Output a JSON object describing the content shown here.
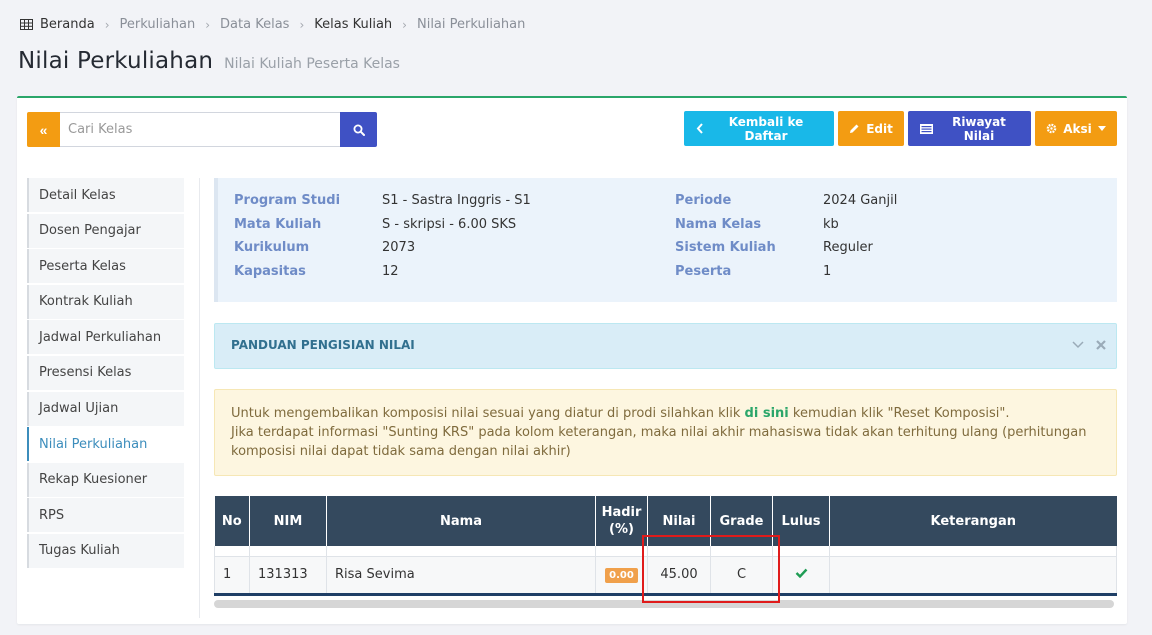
{
  "breadcrumb": {
    "items": [
      "Beranda",
      "Perkuliahan",
      "Data Kelas",
      "Kelas Kuliah",
      "Nilai Perkuliahan"
    ]
  },
  "page": {
    "title": "Nilai Perkuliahan",
    "subtitle": "Nilai Kuliah Peserta Kelas"
  },
  "toolbar": {
    "collapse_label": "«",
    "search_placeholder": "Cari Kelas",
    "back_label": "Kembali ke Daftar",
    "edit_label": "Edit",
    "history_label": "Riwayat Nilai",
    "actions_label": "Aksi"
  },
  "sidebar": {
    "items": [
      {
        "label": "Detail Kelas"
      },
      {
        "label": "Dosen Pengajar"
      },
      {
        "label": "Peserta Kelas"
      },
      {
        "label": "Kontrak Kuliah"
      },
      {
        "label": "Jadwal Perkuliahan"
      },
      {
        "label": "Presensi Kelas"
      },
      {
        "label": "Jadwal Ujian"
      },
      {
        "label": "Nilai Perkuliahan"
      },
      {
        "label": "Rekap Kuesioner"
      },
      {
        "label": "RPS"
      },
      {
        "label": "Tugas Kuliah"
      }
    ],
    "active_index": 7
  },
  "info": {
    "program_studi_label": "Program Studi",
    "program_studi": "S1 - Sastra Inggris - S1",
    "mata_kuliah_label": "Mata Kuliah",
    "mata_kuliah": "S - skripsi - 6.00 SKS",
    "kurikulum_label": "Kurikulum",
    "kurikulum": "2073",
    "kapasitas_label": "Kapasitas",
    "kapasitas": "12",
    "periode_label": "Periode",
    "periode": "2024 Ganjil",
    "nama_kelas_label": "Nama Kelas",
    "nama_kelas": "kb",
    "sistem_kuliah_label": "Sistem Kuliah",
    "sistem_kuliah": "Reguler",
    "peserta_label": "Peserta",
    "peserta": "1"
  },
  "guide": {
    "title": "PANDUAN PENGISIAN NILAI"
  },
  "notice": {
    "line1_before": "Untuk mengembalikan komposisi nilai sesuai yang diatur di prodi silahkan klik ",
    "line1_link": "di sini",
    "line1_after": " kemudian klik \"Reset Komposisi\".",
    "line2": "Jika terdapat informasi \"Sunting KRS\" pada kolom keterangan, maka nilai akhir mahasiswa tidak akan terhitung ulang (perhitungan komposisi nilai dapat tidak sama dengan nilai akhir)"
  },
  "table": {
    "headers": {
      "no": "No",
      "nim": "NIM",
      "nama": "Nama",
      "hadir": "Hadir",
      "hadir_unit": "(%)",
      "nilai": "Nilai",
      "grade": "Grade",
      "lulus": "Lulus",
      "keterangan": "Keterangan"
    },
    "rows": [
      {
        "no": "1",
        "nim": "131313",
        "nama": "Risa Sevima",
        "hadir": "0.00",
        "nilai": "45.00",
        "grade": "C",
        "lulus": true,
        "keterangan": ""
      }
    ]
  },
  "colors": {
    "accent_green": "#2ba66a",
    "orange": "#f39c12",
    "blue": "#3f51c4",
    "cyan": "#19b8e8",
    "table_header": "#34495e",
    "highlight_red": "#e01b1b"
  }
}
